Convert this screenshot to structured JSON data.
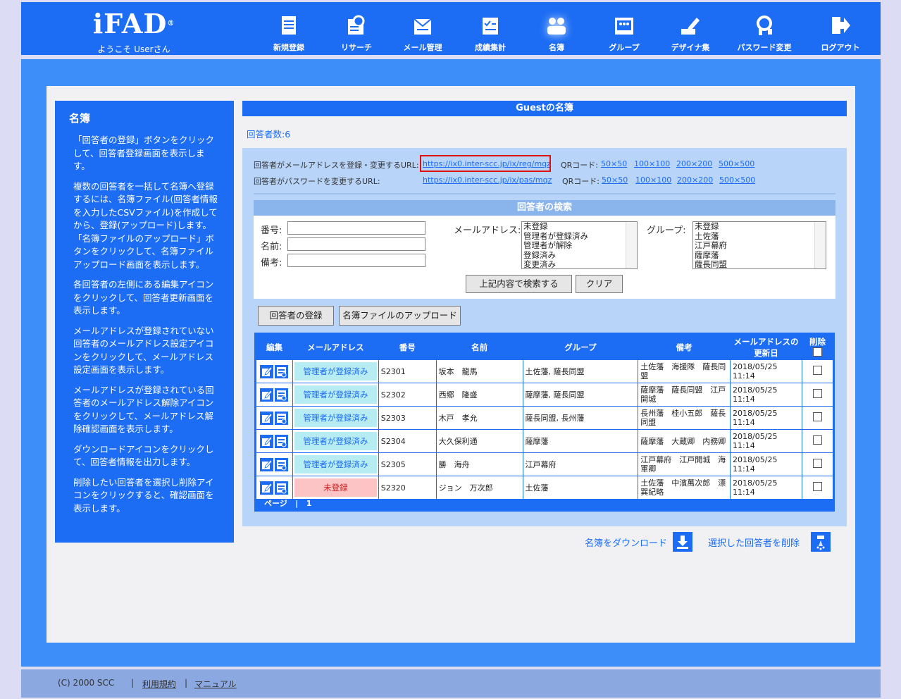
{
  "header": {
    "logo": "iFAD",
    "logo_mark": "®",
    "welcome": "ようこそ Userさん",
    "nav": [
      {
        "label": "新規登録",
        "icon": "document-icon"
      },
      {
        "label": "リサーチ",
        "icon": "research-icon"
      },
      {
        "label": "メール管理",
        "icon": "mail-icon"
      },
      {
        "label": "成績集計",
        "icon": "checklist-icon"
      },
      {
        "label": "名簿",
        "icon": "users-icon",
        "active": true
      },
      {
        "label": "グループ",
        "icon": "group-icon"
      },
      {
        "label": "デザイナ集",
        "icon": "pen-icon"
      },
      {
        "label": "パスワード変更",
        "icon": "key-icon"
      },
      {
        "label": "ログアウト",
        "icon": "logout-icon"
      }
    ]
  },
  "sidebar": {
    "title": "名簿",
    "paragraphs": [
      "「回答者の登録」ボタンをクリックして、回答者登録画面を表示します。",
      "複数の回答者を一括して名簿へ登録するには、名簿ファイル(回答者情報を入力したCSVファイル)を作成してから、登録(アップロード)します。「名簿ファイルのアップロード」ボタンをクリックして、名簿ファイルアップロード画面を表示します。",
      "各回答者の左側にある編集アイコンをクリックして、回答者更新画面を表示します。",
      "メールアドレスが登録されていない回答者のメールアドレス設定アイコンをクリックして、メールアドレス設定画面を表示します。",
      "メールアドレスが登録されている回答者のメールアドレス解除アイコンをクリックして、メールアドレス解除確認画面を表示します。",
      "ダウンロードアイコンをクリックして、回答者情報を出力します。",
      "削除したい回答者を選択し削除アイコンをクリックすると、確認画面を表示します。"
    ]
  },
  "main": {
    "title": "Guestの名簿",
    "count": "回答者数:6",
    "url_rows": [
      {
        "label": "回答者がメールアドレスを登録・変更するURL:",
        "url": "https://ix0.inter-scc.jp/ix/reg/mqz",
        "qr_label": "QRコード:",
        "qr_sizes": [
          "50×50",
          "100×100",
          "200×200",
          "500×500"
        ]
      },
      {
        "label": "回答者がパスワードを変更するURL:",
        "url": "https://ix0.inter-scc.jp/ix/pas/mqz",
        "qr_label": "QRコード:",
        "qr_sizes": [
          "50×50",
          "100×100",
          "200×200",
          "500×500"
        ]
      }
    ],
    "search": {
      "title": "回答者の検索",
      "fields": {
        "number": "番号:",
        "name": "名前:",
        "note": "備考:"
      },
      "mail_label": "メールアドレス:",
      "mail_options": [
        "未登録",
        "管理者が登録済み",
        "管理者が解除",
        "登録済み",
        "変更済み"
      ],
      "group_label": "グループ:",
      "group_options": [
        "未登録",
        "土佐藩",
        "江戸幕府",
        "薩摩藩",
        "薩長同盟"
      ],
      "search_button": "上記内容で検索する",
      "clear_button": "クリア"
    },
    "register_button": "回答者の登録",
    "upload_button": "名簿ファイルのアップロード",
    "table": {
      "headers": [
        "編集",
        "メールアドレス",
        "番号",
        "名前",
        "グループ",
        "備考",
        "メールアドレスの更新日",
        "削除"
      ],
      "rows": [
        {
          "status": "管理者が登録済み",
          "state": "reg",
          "number": "S2301",
          "name": "坂本　龍馬",
          "group": "土佐藩, 薩長同盟",
          "note": "土佐藩　海援隊　薩長同盟",
          "date": "2018/05/25 11:14"
        },
        {
          "status": "管理者が登録済み",
          "state": "reg",
          "number": "S2302",
          "name": "西郷　隆盛",
          "group": "薩摩藩, 薩長同盟",
          "note": "薩摩藩　薩長同盟　江戸開城",
          "date": "2018/05/25 11:14"
        },
        {
          "status": "管理者が登録済み",
          "state": "reg",
          "number": "S2303",
          "name": "木戸　孝允",
          "group": "薩長同盟, 長州藩",
          "note": "長州藩　桂小五郎　薩長同盟",
          "date": "2018/05/25 11:14"
        },
        {
          "status": "管理者が登録済み",
          "state": "reg",
          "number": "S2304",
          "name": "大久保利通",
          "group": "薩摩藩",
          "note": "薩摩藩　大蔵卿　内務卿",
          "date": "2018/05/25 11:14"
        },
        {
          "status": "管理者が登録済み",
          "state": "reg",
          "number": "S2305",
          "name": "勝　海舟",
          "group": "江戸幕府",
          "note": "江戸幕府　江戸開城　海軍卿",
          "date": "2018/05/25 11:14"
        },
        {
          "status": "未登録",
          "state": "unreg",
          "number": "S2320",
          "name": "ジョン　万次郎",
          "group": "土佐藩",
          "note": "土佐藩　中濱萬次郎　漂巽紀略",
          "date": "2018/05/25 11:14"
        }
      ],
      "pager_label": "ページ",
      "pager_page": "1"
    },
    "download_link": "名簿をダウンロード",
    "delete_link": "選択した回答者を削除"
  },
  "footer": {
    "copyright": "(C) 2000 SCC",
    "terms": "利用規約",
    "manual": "マニュアル"
  }
}
